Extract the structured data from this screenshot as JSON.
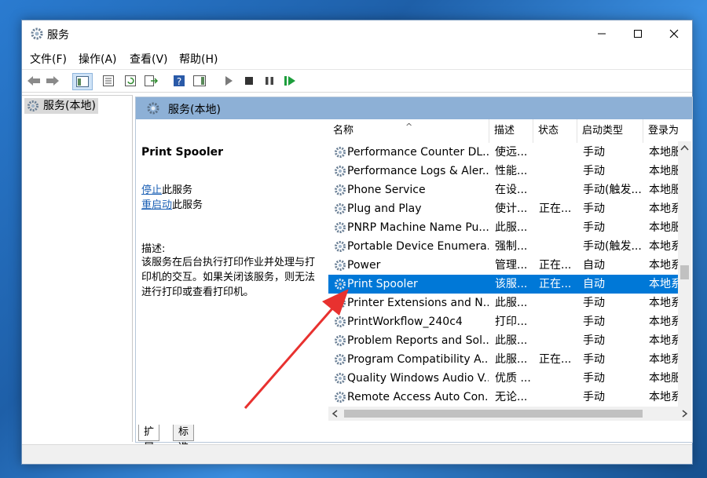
{
  "window": {
    "title": "服务",
    "min_icon": "minimize-icon",
    "max_icon": "maximize-icon",
    "close_icon": "close-icon"
  },
  "menu": [
    "文件(F)",
    "操作(A)",
    "查看(V)",
    "帮助(H)"
  ],
  "tree": {
    "root_label": "服务(本地)"
  },
  "panel": {
    "header": "服务(本地)"
  },
  "description": {
    "service_title": "Print Spooler",
    "stop_link": "停止",
    "stop_suffix": "此服务",
    "restart_link": "重启动",
    "restart_suffix": "此服务",
    "desc_label": "描述:",
    "desc_text": "该服务在后台执行打印作业并处理与打印机的交互。如果关闭该服务，则无法进行打印或查看打印机。"
  },
  "columns": [
    "名称",
    "描述",
    "状态",
    "启动类型",
    "登录为"
  ],
  "rows": [
    {
      "name": "Performance Counter DL...",
      "desc": "使远...",
      "status": "",
      "startup": "手动",
      "logon": "本地服"
    },
    {
      "name": "Performance Logs & Aler...",
      "desc": "性能...",
      "status": "",
      "startup": "手动",
      "logon": "本地服"
    },
    {
      "name": "Phone Service",
      "desc": "在设...",
      "status": "",
      "startup": "手动(触发...",
      "logon": "本地服"
    },
    {
      "name": "Plug and Play",
      "desc": "使计...",
      "status": "正在...",
      "startup": "手动",
      "logon": "本地系"
    },
    {
      "name": "PNRP Machine Name Pu...",
      "desc": "此服...",
      "status": "",
      "startup": "手动",
      "logon": "本地服"
    },
    {
      "name": "Portable Device Enumera...",
      "desc": "强制...",
      "status": "",
      "startup": "手动(触发...",
      "logon": "本地系"
    },
    {
      "name": "Power",
      "desc": "管理...",
      "status": "正在...",
      "startup": "自动",
      "logon": "本地系"
    },
    {
      "name": "Print Spooler",
      "desc": "该服...",
      "status": "正在...",
      "startup": "自动",
      "logon": "本地系",
      "selected": true
    },
    {
      "name": "Printer Extensions and N...",
      "desc": "此服...",
      "status": "",
      "startup": "手动",
      "logon": "本地系"
    },
    {
      "name": "PrintWorkflow_240c4",
      "desc": "打印...",
      "status": "",
      "startup": "手动",
      "logon": "本地系"
    },
    {
      "name": "Problem Reports and Sol...",
      "desc": "此服...",
      "status": "",
      "startup": "手动",
      "logon": "本地系"
    },
    {
      "name": "Program Compatibility A...",
      "desc": "此服...",
      "status": "正在...",
      "startup": "手动",
      "logon": "本地系"
    },
    {
      "name": "Quality Windows Audio V...",
      "desc": "优质 ...",
      "status": "",
      "startup": "手动",
      "logon": "本地服"
    },
    {
      "name": "Remote Access Auto Con...",
      "desc": "无论...",
      "status": "",
      "startup": "手动",
      "logon": "本地系"
    }
  ],
  "tabs": [
    "扩展",
    "标准"
  ],
  "colors": {
    "selection": "#0078d7",
    "header_band": "#8db0d6",
    "annotation_arrow": "#e8312f"
  }
}
